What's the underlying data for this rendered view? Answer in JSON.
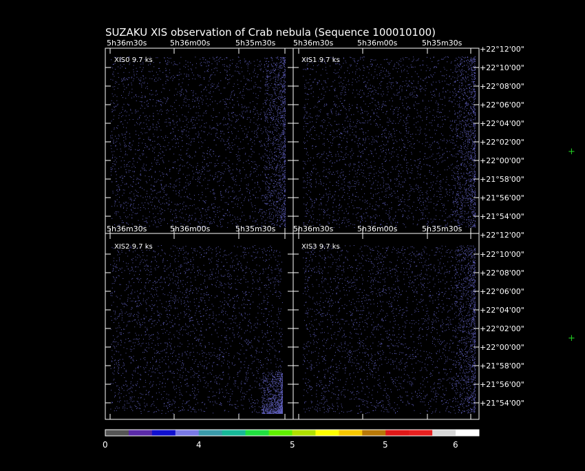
{
  "title": "SUZAKU XIS observation of Crab nebula  (Sequence 100010100)",
  "ra_ticks_top": [
    "5h36m30s",
    "5h36m00s",
    "5h35m30s"
  ],
  "ra_ticks_mid": [
    "5h36m30s",
    "5h36m00s",
    "5h35m30s"
  ],
  "dec_ticks": [
    "+22°12'00\"",
    "+22°10'00\"",
    "+22°08'00\"",
    "+22°06'00\"",
    "+22°04'00\"",
    "+22°02'00\"",
    "+22°00'00\"",
    "+21°58'00\"",
    "+21°56'00\"",
    "+21°54'00\""
  ],
  "panels": [
    {
      "label": "XIS0 9.7 ks"
    },
    {
      "label": "XIS1 9.7 ks"
    },
    {
      "label": "XIS2 9.7 ks"
    },
    {
      "label": "XIS3 9.7 ks"
    }
  ],
  "colorbar": {
    "colors": [
      "#555555",
      "#5a2aa8",
      "#1010d0",
      "#7a7ae6",
      "#3a9aaa",
      "#17b898",
      "#20e040",
      "#60f000",
      "#b0e000",
      "#ffff00",
      "#f8c800",
      "#b87808",
      "#e01818",
      "#e82020",
      "#d8d8d8",
      "#ffffff"
    ],
    "labels": [
      "0",
      "4",
      "5",
      "5",
      "6"
    ]
  },
  "markers": [
    "+",
    "+"
  ],
  "colors": {
    "background": "#000000",
    "event_dots": "#6f6fdc",
    "marker": "#22cc22"
  }
}
